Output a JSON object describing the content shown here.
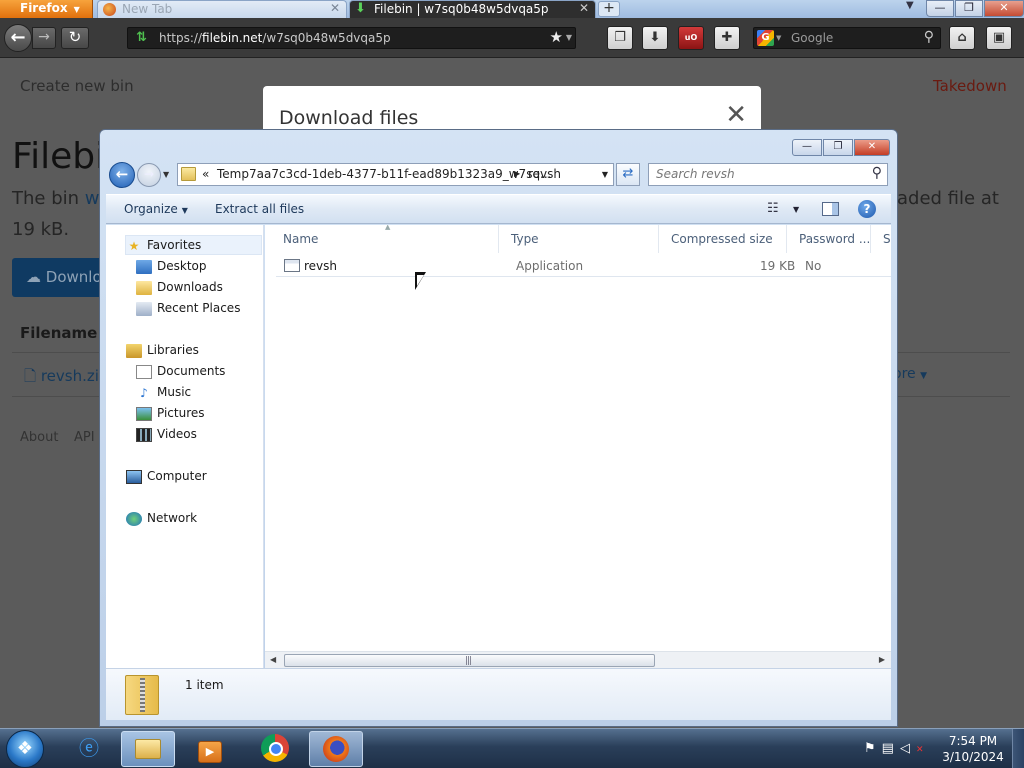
{
  "browser": {
    "menu_label": "Firefox",
    "tabs": [
      {
        "title": "New Tab",
        "active": false
      },
      {
        "title": "Filebin | w7sq0b48w5dvqa5p",
        "active": true
      }
    ],
    "url_prefix": "https://",
    "url_domain": "filebin.net",
    "url_path": "/w7sq0b48w5dvqa5p",
    "search_engine": "G",
    "search_placeholder": "Google"
  },
  "page": {
    "create_bin": "Create new bin",
    "takedown": "Takedown",
    "title": "Filebi",
    "desc_start": "The bin ",
    "desc_link": "w7",
    "desc_end": "aded file at",
    "desc_line2": "19 kB.",
    "download_button": "Downlo",
    "filename_header": "Filename",
    "file_link": "revsh.zi",
    "more_link": "ore",
    "footer": [
      "About",
      "API"
    ]
  },
  "modal": {
    "title": "Download files",
    "close_glyph": "✕"
  },
  "explorer": {
    "address": {
      "overflow": "«",
      "parts": [
        "Temp7aa7c3cd-1deb-4377-b11f-ead89b1323a9_w7sq...",
        "revsh"
      ]
    },
    "search_placeholder": "Search revsh",
    "toolbar": {
      "organize": "Organize",
      "extract": "Extract all files"
    },
    "nav": {
      "favorites": "Favorites",
      "desktop": "Desktop",
      "downloads": "Downloads",
      "recent": "Recent Places",
      "libraries": "Libraries",
      "documents": "Documents",
      "music": "Music",
      "pictures": "Pictures",
      "videos": "Videos",
      "computer": "Computer",
      "network": "Network"
    },
    "columns": [
      "Name",
      "Type",
      "Compressed size",
      "Password ...",
      "Si"
    ],
    "files": [
      {
        "name": "revsh",
        "type": "Application",
        "compressed_size": "19 KB",
        "password": "No"
      }
    ],
    "status": "1 item"
  },
  "taskbar": {
    "time": "7:54 PM",
    "date": "3/10/2024"
  },
  "colors": {
    "firefox_orange": "#e0700d",
    "explorer_frame": "#bccfe8",
    "close_red": "#c43d25",
    "link_blue": "#163a5c"
  }
}
